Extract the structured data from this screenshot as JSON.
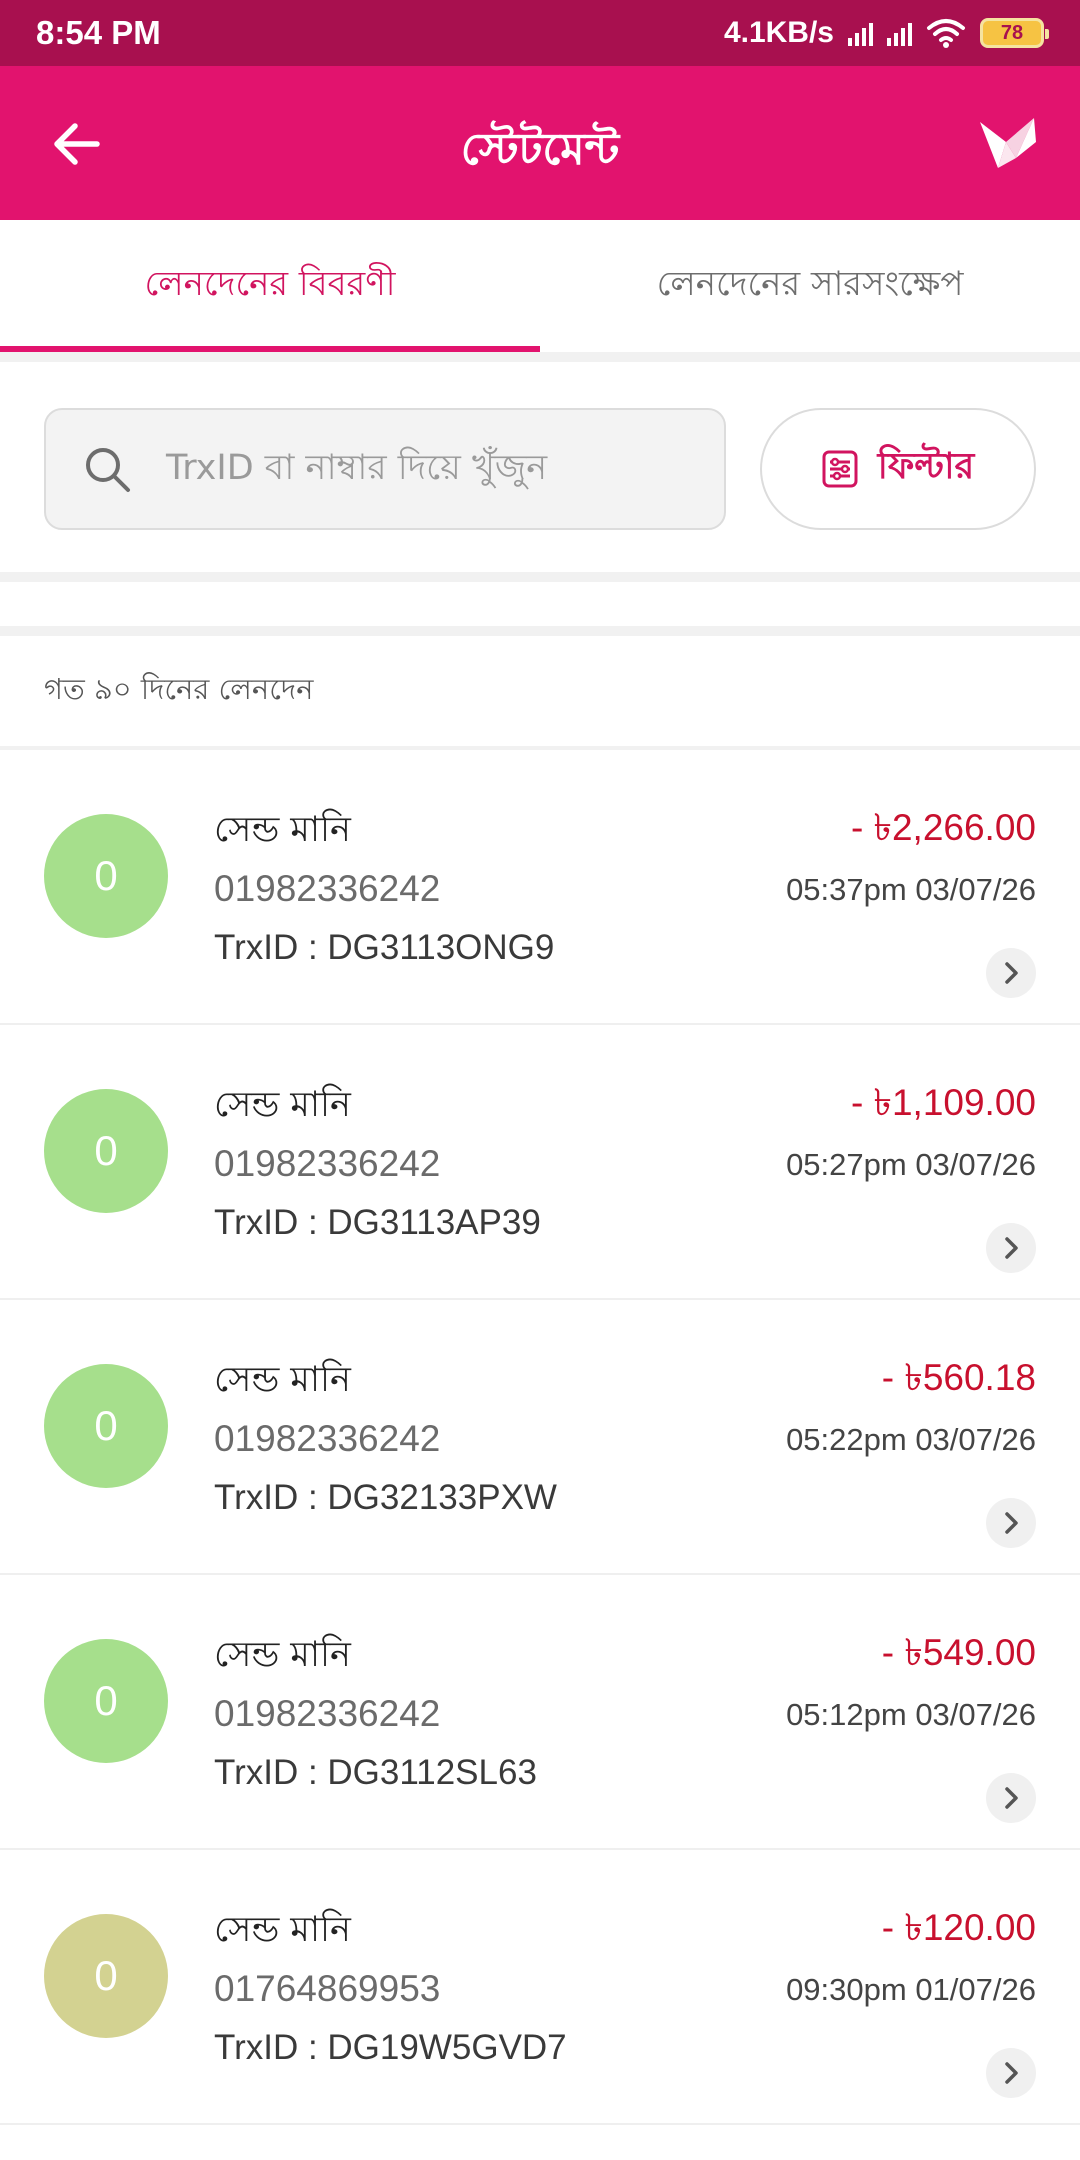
{
  "status_bar": {
    "time": "8:54 PM",
    "net_speed": "4.1KB/s",
    "battery": "78"
  },
  "header": {
    "title": "স্টেটমেন্ট",
    "back_icon": "arrow-left-icon",
    "logo_icon": "bird-logo-icon"
  },
  "tabs": [
    {
      "label": "লেনদেনের বিবরণী",
      "active": true
    },
    {
      "label": "লেনদেনের সারসংক্ষেপ",
      "active": false
    }
  ],
  "search": {
    "placeholder": "TrxID বা নাম্বার দিয়ে খুঁজুন"
  },
  "filter": {
    "label": "ফিল্টার"
  },
  "section": {
    "title": "গত ৯০ দিনের লেনদেন"
  },
  "transactions": [
    {
      "avatar": "0",
      "avatar_color": "#a6df8c",
      "type": "সেন্ড মানি",
      "number": "01982336242",
      "trxid": "TrxID : DG3113ONG9",
      "amount": "- ৳2,266.00",
      "datetime": "05:37pm 03/07/26"
    },
    {
      "avatar": "0",
      "avatar_color": "#a6df8c",
      "type": "সেন্ড মানি",
      "number": "01982336242",
      "trxid": "TrxID : DG3113AP39",
      "amount": "- ৳1,109.00",
      "datetime": "05:27pm 03/07/26"
    },
    {
      "avatar": "0",
      "avatar_color": "#a6df8c",
      "type": "সেন্ড মানি",
      "number": "01982336242",
      "trxid": "TrxID : DG32133PXW",
      "amount": "- ৳560.18",
      "datetime": "05:22pm 03/07/26"
    },
    {
      "avatar": "0",
      "avatar_color": "#a6df8c",
      "type": "সেন্ড মানি",
      "number": "01982336242",
      "trxid": "TrxID : DG3112SL63",
      "amount": "- ৳549.00",
      "datetime": "05:12pm 03/07/26"
    },
    {
      "avatar": "0",
      "avatar_color": "#d3d291",
      "type": "সেন্ড মানি",
      "number": "01764869953",
      "trxid": "TrxID : DG19W5GVD7",
      "amount": "- ৳120.00",
      "datetime": "09:30pm 01/07/26"
    }
  ],
  "colors": {
    "brand": "#e2136e",
    "status_bar": "#a8104f",
    "amount": "#c8102e"
  }
}
